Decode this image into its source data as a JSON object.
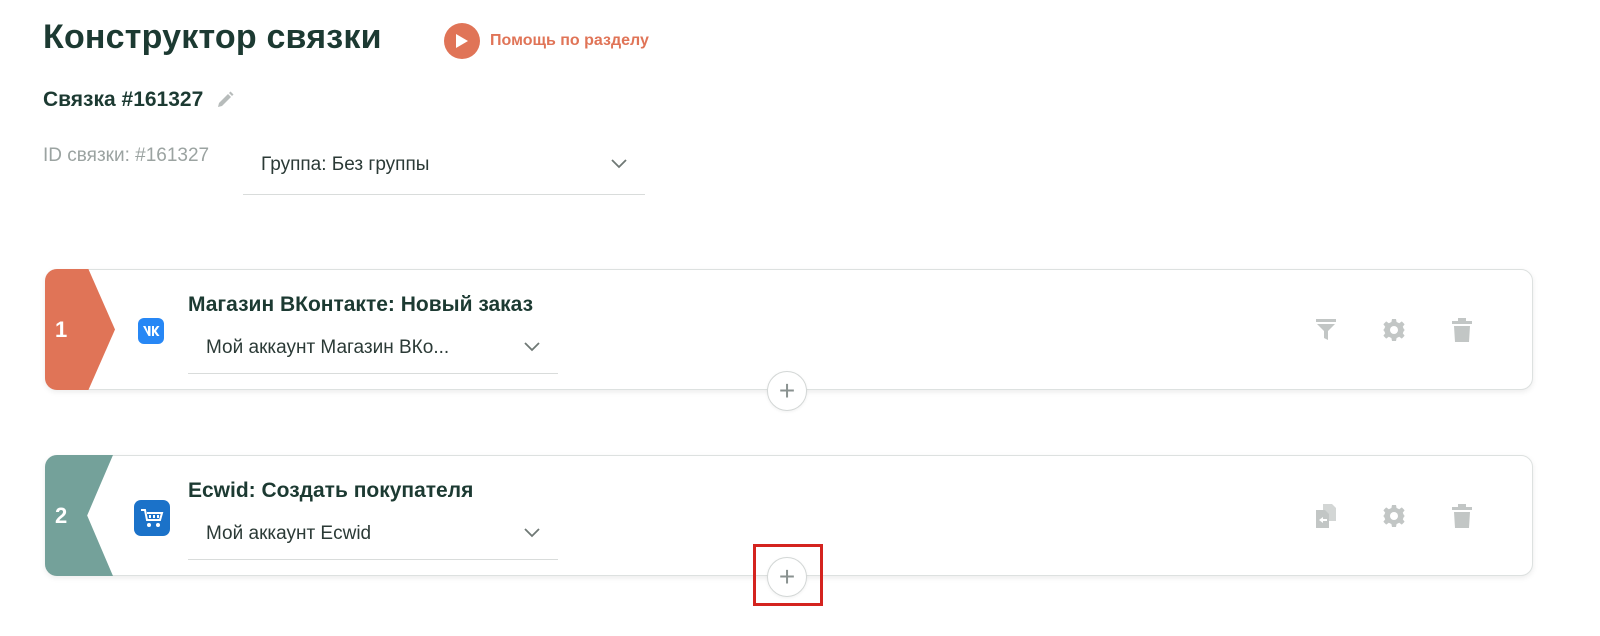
{
  "header": {
    "title": "Конструктор связки",
    "help_label": "Помощь по разделу"
  },
  "bundle": {
    "name": "Связка #161327",
    "id_label": "ID связки: #161327",
    "group_value": "Группа: Без группы"
  },
  "steps": [
    {
      "number": "1",
      "title": "Магазин ВКонтакте: Новый заказ",
      "account": "Мой аккаунт Магазин ВКо...",
      "icon": "vk-icon",
      "actions": [
        "filter-icon",
        "gear-icon",
        "trash-icon"
      ]
    },
    {
      "number": "2",
      "title": "Ecwid: Создать покупателя",
      "account": "Мой аккаунт Ecwid",
      "icon": "ecwid-cart-icon",
      "actions": [
        "copy-icon",
        "gear-icon",
        "trash-icon"
      ]
    }
  ],
  "add_button_label": "+",
  "colors": {
    "accent": "#e07457",
    "step1": "#e07457",
    "step2": "#74a19a",
    "title": "#1c3a32",
    "highlight": "#d4231f"
  }
}
